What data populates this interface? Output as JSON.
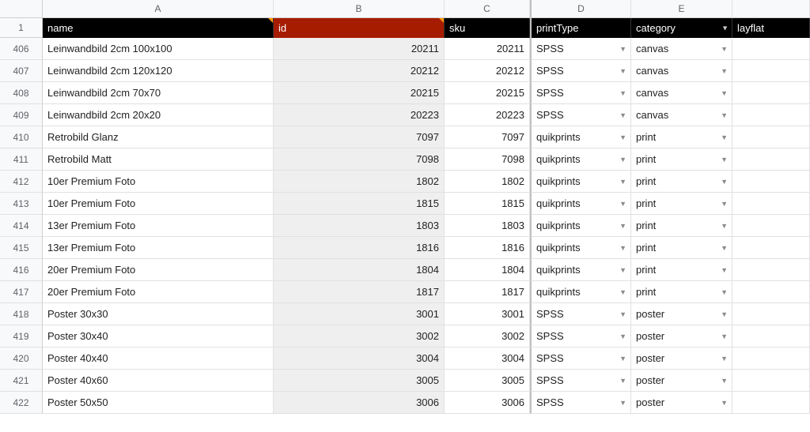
{
  "columns": [
    "A",
    "B",
    "C",
    "D",
    "E",
    ""
  ],
  "header_row_number": "1",
  "headers": {
    "name": "name",
    "id": "id",
    "sku": "sku",
    "printType": "printType",
    "category": "category",
    "layflat": "layflat"
  },
  "row_numbers": [
    "406",
    "407",
    "408",
    "409",
    "410",
    "411",
    "412",
    "413",
    "414",
    "415",
    "416",
    "417",
    "418",
    "419",
    "420",
    "421",
    "422"
  ],
  "rows": [
    {
      "name": "Leinwandbild 2cm 100x100",
      "id": "20211",
      "sku": "20211",
      "printType": "SPSS",
      "category": "canvas",
      "layflat": ""
    },
    {
      "name": "Leinwandbild 2cm 120x120",
      "id": "20212",
      "sku": "20212",
      "printType": "SPSS",
      "category": "canvas",
      "layflat": ""
    },
    {
      "name": "Leinwandbild 2cm 70x70",
      "id": "20215",
      "sku": "20215",
      "printType": "SPSS",
      "category": "canvas",
      "layflat": ""
    },
    {
      "name": "Leinwandbild 2cm 20x20",
      "id": "20223",
      "sku": "20223",
      "printType": "SPSS",
      "category": "canvas",
      "layflat": ""
    },
    {
      "name": "Retrobild Glanz",
      "id": "7097",
      "sku": "7097",
      "printType": "quikprints",
      "category": "print",
      "layflat": ""
    },
    {
      "name": "Retrobild Matt",
      "id": "7098",
      "sku": "7098",
      "printType": "quikprints",
      "category": "print",
      "layflat": ""
    },
    {
      "name": "10er Premium Foto",
      "id": "1802",
      "sku": "1802",
      "printType": "quikprints",
      "category": "print",
      "layflat": ""
    },
    {
      "name": "10er Premium Foto",
      "id": "1815",
      "sku": "1815",
      "printType": "quikprints",
      "category": "print",
      "layflat": ""
    },
    {
      "name": "13er Premium Foto",
      "id": "1803",
      "sku": "1803",
      "printType": "quikprints",
      "category": "print",
      "layflat": ""
    },
    {
      "name": "13er Premium Foto",
      "id": "1816",
      "sku": "1816",
      "printType": "quikprints",
      "category": "print",
      "layflat": ""
    },
    {
      "name": "20er Premium Foto",
      "id": "1804",
      "sku": "1804",
      "printType": "quikprints",
      "category": "print",
      "layflat": ""
    },
    {
      "name": "20er Premium Foto",
      "id": "1817",
      "sku": "1817",
      "printType": "quikprints",
      "category": "print",
      "layflat": ""
    },
    {
      "name": "Poster 30x30",
      "id": "3001",
      "sku": "3001",
      "printType": "SPSS",
      "category": "poster",
      "layflat": ""
    },
    {
      "name": "Poster 30x40",
      "id": "3002",
      "sku": "3002",
      "printType": "SPSS",
      "category": "poster",
      "layflat": ""
    },
    {
      "name": "Poster 40x40",
      "id": "3004",
      "sku": "3004",
      "printType": "SPSS",
      "category": "poster",
      "layflat": ""
    },
    {
      "name": "Poster 40x60",
      "id": "3005",
      "sku": "3005",
      "printType": "SPSS",
      "category": "poster",
      "layflat": ""
    },
    {
      "name": "Poster 50x50",
      "id": "3006",
      "sku": "3006",
      "printType": "SPSS",
      "category": "poster",
      "layflat": ""
    }
  ]
}
